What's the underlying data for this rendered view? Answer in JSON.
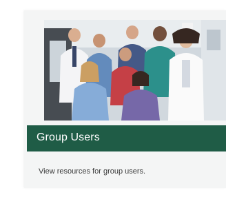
{
  "card": {
    "title": "Group Users",
    "description": "View resources for group users.",
    "photo_icon": "medical-team-photo",
    "banner_color": "#1f5c46"
  }
}
